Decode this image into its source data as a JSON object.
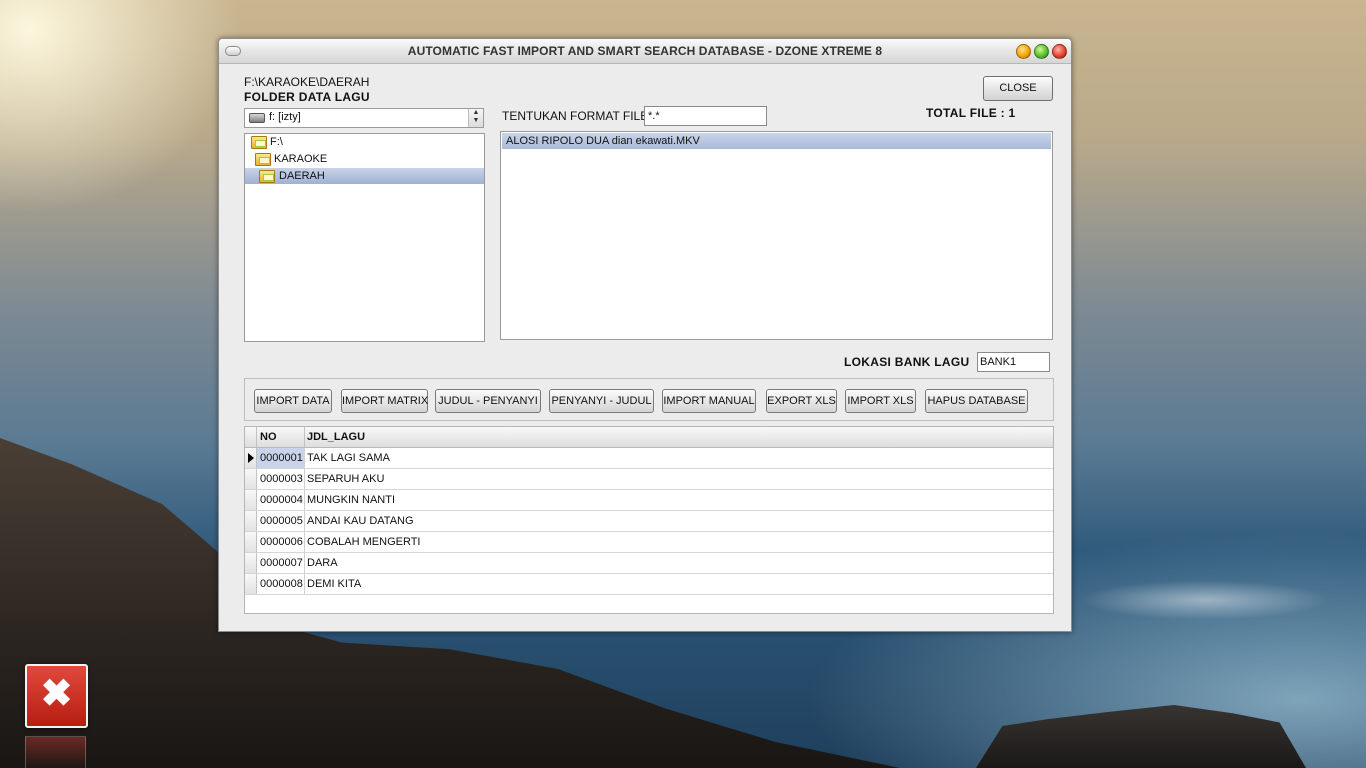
{
  "window": {
    "title": "AUTOMATIC FAST IMPORT AND SMART SEARCH DATABASE - DZONE XTREME 8",
    "current_path": "F:\\KARAOKE\\DAERAH",
    "folder_title": "FOLDER DATA LAGU",
    "close_label": "CLOSE"
  },
  "drive": {
    "selected": "f: [izty]"
  },
  "folder_tree": [
    {
      "label": "F:\\",
      "selected": false
    },
    {
      "label": "KARAOKE",
      "selected": false
    },
    {
      "label": "DAERAH",
      "selected": true
    }
  ],
  "format": {
    "label": "TENTUKAN FORMAT FILE",
    "value": "*.*"
  },
  "total_file": "TOTAL FILE : 1",
  "files": [
    "ALOSI RIPOLO DUA dian ekawati.MKV"
  ],
  "bank": {
    "label": "LOKASI BANK LAGU",
    "value": "BANK1"
  },
  "actions": [
    "IMPORT DATA",
    "IMPORT MATRIX",
    "JUDUL - PENYANYI",
    "PENYANYI - JUDUL",
    "IMPORT MANUAL",
    "EXPORT XLS",
    "IMPORT XLS",
    "HAPUS DATABASE"
  ],
  "grid": {
    "columns": [
      "NO",
      "JDL_LAGU"
    ],
    "rows": [
      {
        "no": "0000001",
        "title": "TAK LAGI SAMA"
      },
      {
        "no": "0000003",
        "title": "SEPARUH AKU"
      },
      {
        "no": "0000004",
        "title": "MUNGKIN NANTI"
      },
      {
        "no": "0000005",
        "title": "ANDAI KAU DATANG"
      },
      {
        "no": "0000006",
        "title": "COBALAH MENGERTI"
      },
      {
        "no": "0000007",
        "title": "DARA"
      },
      {
        "no": "0000008",
        "title": "DEMI KITA"
      }
    ]
  },
  "desktop": {
    "close_tile_icon": "close-x-icon",
    "close_glyph": "✖"
  },
  "colors": {
    "selection": "#a9b9d9",
    "desktop_close": "#c9281a"
  }
}
